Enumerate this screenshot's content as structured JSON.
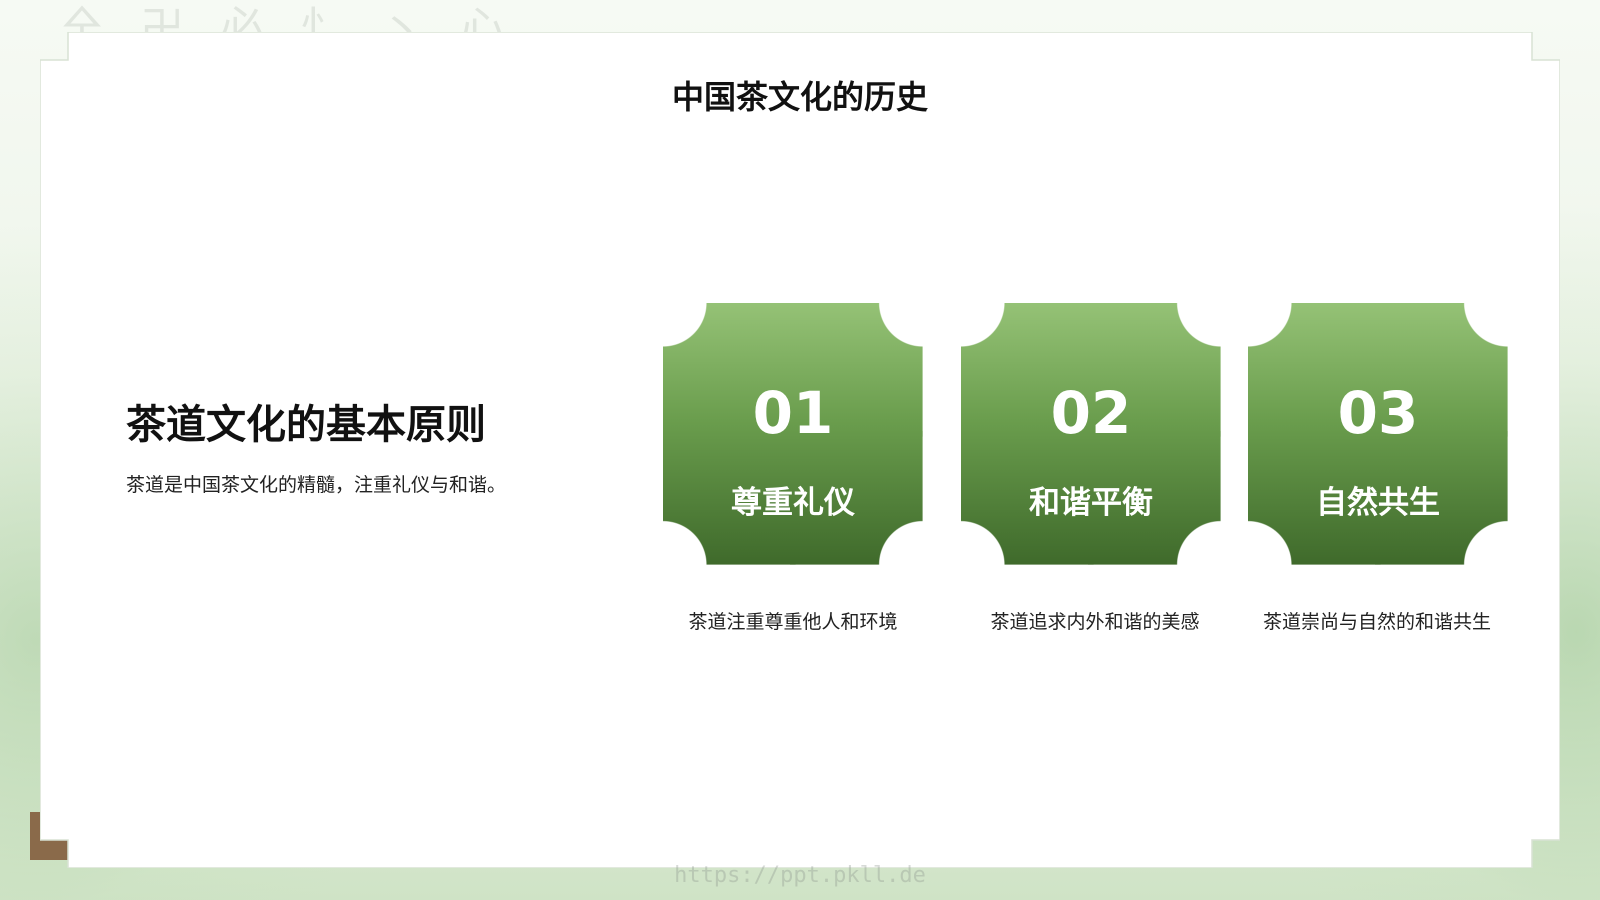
{
  "header": {
    "title": "中国茶文化的历史"
  },
  "main": {
    "title": "茶道文化的基本原则",
    "description": "茶道是中国茶文化的精髓，注重礼仪与和谐。"
  },
  "cards": [
    {
      "number": "01",
      "label": "尊重礼仪",
      "caption": "茶道注重尊重他人和环境"
    },
    {
      "number": "02",
      "label": "和谐平衡",
      "caption": "茶道追求内外和谐的美感"
    },
    {
      "number": "03",
      "label": "自然共生",
      "caption": "茶道崇尚与自然的和谐共生"
    }
  ],
  "watermark": "https://ppt.pkll.de",
  "colors": {
    "card_top": "#95c276",
    "card_bottom": "#3f6a2b",
    "background_mist": "#cfe3c6"
  }
}
